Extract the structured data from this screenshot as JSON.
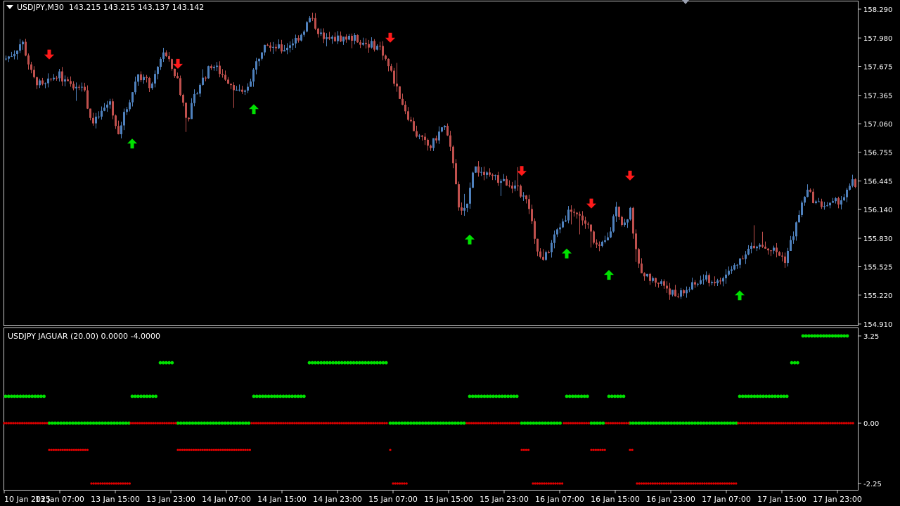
{
  "main_chart": {
    "symbol_header": "USDJPY,M30",
    "ohlc_header": "143.215 143.215 143.137 143.142",
    "price_labels": [
      "158.290",
      "157.980",
      "157.675",
      "157.365",
      "157.060",
      "156.755",
      "156.445",
      "156.140",
      "155.830",
      "155.525",
      "155.220",
      "154.910"
    ]
  },
  "indicator": {
    "header": "USDJPY  JAGUAR (20.00) 0.0000 -4.0000",
    "level_labels": [
      "3.25",
      "0.00",
      "-2.25"
    ]
  },
  "time_labels": [
    "10 Jan 2025",
    "13 Jan 07:00",
    "13 Jan 15:00",
    "13 Jan 23:00",
    "14 Jan 07:00",
    "14 Jan 15:00",
    "14 Jan 23:00",
    "15 Jan 07:00",
    "15 Jan 15:00",
    "15 Jan 23:00",
    "16 Jan 07:00",
    "16 Jan 15:00",
    "16 Jan 23:00",
    "17 Jan 07:00",
    "17 Jan 15:00",
    "17 Jan 23:00"
  ],
  "colors": {
    "background": "#000000",
    "bull_candle": "#4f81bd",
    "bear_candle": "#c0504d",
    "up_arrow": "#00e000",
    "down_arrow": "#ff1a1a",
    "dot_green": "#00e000",
    "dot_red": "#e00000",
    "axis": "#ffffff"
  },
  "chart_data": {
    "type": "candlestick",
    "price_axis": [
      154.91,
      158.29
    ],
    "path_points": [
      [
        0,
        157.72
      ],
      [
        18,
        157.82
      ],
      [
        30,
        157.95
      ],
      [
        45,
        157.55
      ],
      [
        60,
        157.45
      ],
      [
        80,
        157.6
      ],
      [
        100,
        157.45
      ],
      [
        115,
        157.5
      ],
      [
        130,
        157.05
      ],
      [
        155,
        157.3
      ],
      [
        165,
        156.95
      ],
      [
        180,
        157.25
      ],
      [
        195,
        157.6
      ],
      [
        215,
        157.45
      ],
      [
        230,
        157.85
      ],
      [
        250,
        157.55
      ],
      [
        265,
        157.1
      ],
      [
        280,
        157.45
      ],
      [
        300,
        157.7
      ],
      [
        320,
        157.55
      ],
      [
        345,
        157.35
      ],
      [
        360,
        157.65
      ],
      [
        375,
        157.95
      ],
      [
        400,
        157.85
      ],
      [
        425,
        158.0
      ],
      [
        440,
        158.2
      ],
      [
        460,
        157.95
      ],
      [
        480,
        157.98
      ],
      [
        500,
        157.98
      ],
      [
        520,
        157.92
      ],
      [
        540,
        157.88
      ],
      [
        555,
        157.6
      ],
      [
        570,
        157.3
      ],
      [
        590,
        156.95
      ],
      [
        610,
        156.8
      ],
      [
        630,
        157.05
      ],
      [
        645,
        156.6
      ],
      [
        652,
        156.05
      ],
      [
        662,
        156.2
      ],
      [
        672,
        156.6
      ],
      [
        690,
        156.5
      ],
      [
        710,
        156.45
      ],
      [
        730,
        156.4
      ],
      [
        750,
        156.2
      ],
      [
        760,
        155.75
      ],
      [
        770,
        155.55
      ],
      [
        790,
        155.9
      ],
      [
        810,
        156.15
      ],
      [
        825,
        156.05
      ],
      [
        835,
        155.95
      ],
      [
        850,
        155.7
      ],
      [
        865,
        155.85
      ],
      [
        875,
        156.2
      ],
      [
        885,
        155.95
      ],
      [
        895,
        156.15
      ],
      [
        905,
        155.55
      ],
      [
        920,
        155.4
      ],
      [
        940,
        155.35
      ],
      [
        960,
        155.2
      ],
      [
        980,
        155.3
      ],
      [
        1000,
        155.4
      ],
      [
        1020,
        155.35
      ],
      [
        1040,
        155.5
      ],
      [
        1060,
        155.7
      ],
      [
        1080,
        155.75
      ],
      [
        1100,
        155.7
      ],
      [
        1115,
        155.6
      ],
      [
        1130,
        155.95
      ],
      [
        1145,
        156.35
      ],
      [
        1160,
        156.2
      ],
      [
        1180,
        156.18
      ],
      [
        1200,
        156.28
      ],
      [
        1213,
        156.45
      ],
      [
        1218,
        156.3
      ]
    ],
    "up_arrows_price": [
      [
        188,
        156.9
      ],
      [
        361,
        157.27
      ],
      [
        668,
        155.87
      ],
      [
        806,
        155.72
      ],
      [
        866,
        155.49
      ],
      [
        1052,
        155.27
      ]
    ],
    "down_arrows_price": [
      [
        70,
        157.75
      ],
      [
        253,
        157.65
      ],
      [
        555,
        157.93
      ],
      [
        742,
        156.5
      ],
      [
        841,
        156.15
      ],
      [
        896,
        156.45
      ]
    ],
    "indicator_series": [
      {
        "color": "green",
        "y": 3.25,
        "segments": [
          [
            1142,
            1208
          ]
        ]
      },
      {
        "color": "green",
        "y": 2.25,
        "segments": [
          [
            228,
            248
          ],
          [
            440,
            550
          ],
          [
            1126,
            1138
          ]
        ]
      },
      {
        "color": "green",
        "y": 1.0,
        "segments": [
          [
            8,
            66
          ],
          [
            188,
            224
          ],
          [
            361,
            436
          ],
          [
            668,
            738
          ],
          [
            806,
            836
          ],
          [
            866,
            890
          ],
          [
            1052,
            1122
          ]
        ]
      },
      {
        "color": "green",
        "y": 0.0,
        "segments": [
          [
            70,
            184
          ],
          [
            253,
            356
          ],
          [
            555,
            662
          ],
          [
            742,
            800
          ],
          [
            841,
            860
          ],
          [
            896,
            1048
          ]
        ]
      },
      {
        "color": "red",
        "y": 0.0,
        "segments": [
          [
            6,
            68
          ],
          [
            186,
            250
          ],
          [
            358,
            552
          ],
          [
            664,
            740
          ],
          [
            802,
            840
          ],
          [
            862,
            894
          ],
          [
            1050,
            1216
          ]
        ]
      },
      {
        "color": "red",
        "y": -1.0,
        "segments": [
          [
            70,
            126
          ],
          [
            253,
            358
          ],
          [
            555,
            556
          ],
          [
            742,
            754
          ],
          [
            841,
            862
          ],
          [
            896,
            902
          ]
        ]
      },
      {
        "color": "red",
        "y": -2.25,
        "segments": [
          [
            130,
            186
          ],
          [
            559,
            581
          ],
          [
            758,
            802
          ],
          [
            906,
            1048
          ]
        ]
      }
    ]
  }
}
